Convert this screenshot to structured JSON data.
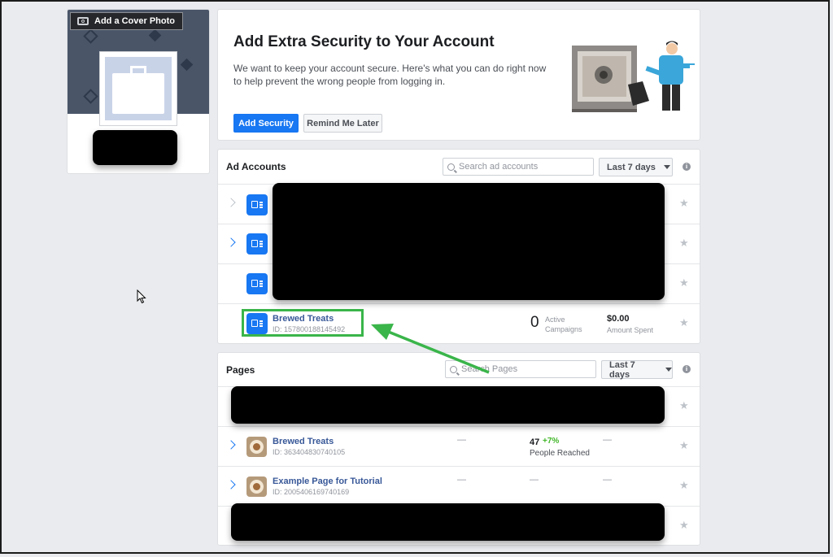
{
  "profile": {
    "cover_button": "Add a Cover Photo"
  },
  "security": {
    "title": "Add Extra Security to Your Account",
    "text": "We want to keep your account secure. Here's what you can do right now to help prevent the wrong people from logging in.",
    "primary_button": "Add Security",
    "secondary_button": "Remind Me Later"
  },
  "ad_accounts": {
    "title": "Ad Accounts",
    "search_placeholder": "Search ad accounts",
    "range": "Last 7 days",
    "featured": {
      "name": "Brewed Treats",
      "id": "ID: 157800188145492",
      "campaigns_value": "0",
      "campaigns_label_1": "Active",
      "campaigns_label_2": "Campaigns",
      "spent_value": "$0.00",
      "spent_label": "Amount Spent"
    }
  },
  "pages": {
    "title": "Pages",
    "search_placeholder": "Search Pages",
    "range": "Last 7 days",
    "rows": [
      {
        "name": "Brewed Treats",
        "id": "ID: 363404830740105",
        "dash1": "—",
        "reached": "47",
        "change": "+7%",
        "reached_label": "People Reached",
        "dash2": "—"
      },
      {
        "name": "Example Page for Tutorial",
        "id": "ID: 2005406169740169",
        "dash1": "—",
        "dash_mid": "—",
        "dash2": "—"
      }
    ]
  },
  "colors": {
    "accent": "#1877f2",
    "highlight": "#3ab54a",
    "link": "#385898"
  },
  "icons": [
    "camera-icon",
    "search-icon",
    "chevron-right-icon",
    "star-icon",
    "info-icon",
    "ad-account-icon",
    "page-avatar-icon",
    "caret-down-icon"
  ]
}
